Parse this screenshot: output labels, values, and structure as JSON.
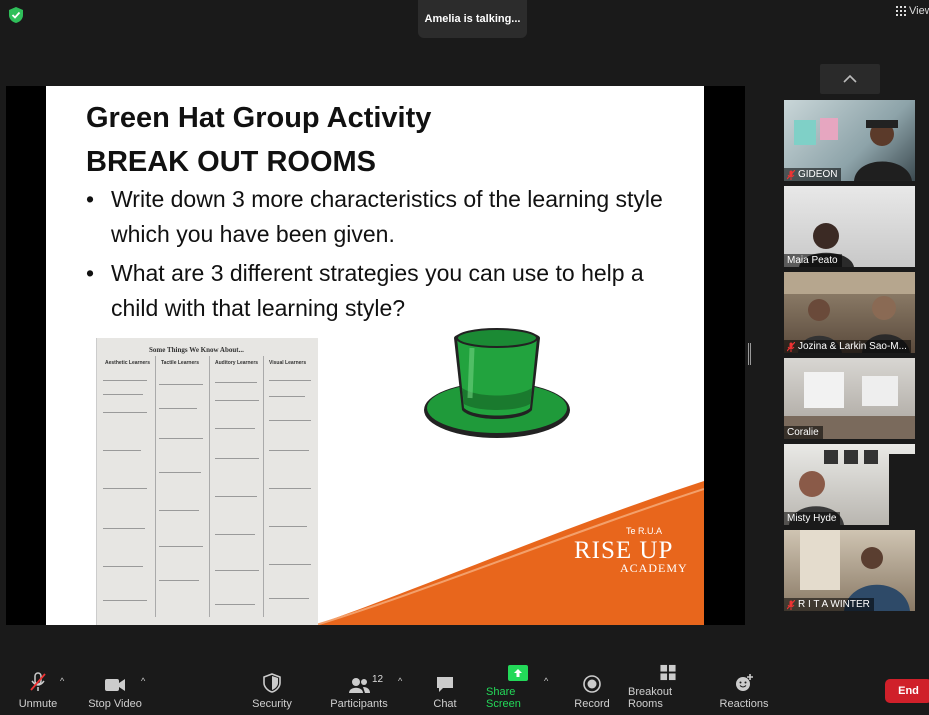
{
  "top_bar": {
    "talking_text": "Amelia is talking...",
    "view_label": "View"
  },
  "slide": {
    "title_line1": "Green Hat Group Activity",
    "title_line2": "BREAK OUT ROOMS",
    "bullets": [
      "Write down 3 more characteristics of the learning style which you have been given.",
      "What are 3 different strategies you can use to help a child with that learning style?"
    ],
    "handout_title": "Some Things We Know About...",
    "handout_columns": [
      "Aesthetic Learners",
      "Tactile Learners",
      "Auditory Learners",
      "Visual Learners"
    ],
    "logo_top": "Te R.U.A",
    "logo_main": "RISE UP",
    "logo_sub": "ACADEMY",
    "colors": {
      "accent_orange": "#e8661c",
      "hat_green": "#1f9a3a"
    }
  },
  "participants_gallery": [
    {
      "name": "GIDEON",
      "muted": true
    },
    {
      "name": "Maia Peato",
      "muted": false
    },
    {
      "name": "Jozina & Larkin Sao-M...",
      "muted": true
    },
    {
      "name": "Coralie",
      "muted": false
    },
    {
      "name": "Misty Hyde",
      "muted": false
    },
    {
      "name": "R I T A WINTER",
      "muted": true
    }
  ],
  "toolbar": {
    "unmute": "Unmute",
    "stop_video": "Stop Video",
    "security": "Security",
    "participants": "Participants",
    "participants_count": "12",
    "chat": "Chat",
    "share_screen": "Share Screen",
    "record": "Record",
    "breakout_rooms": "Breakout Rooms",
    "reactions": "Reactions",
    "end": "End",
    "share_color": "#23d959"
  }
}
